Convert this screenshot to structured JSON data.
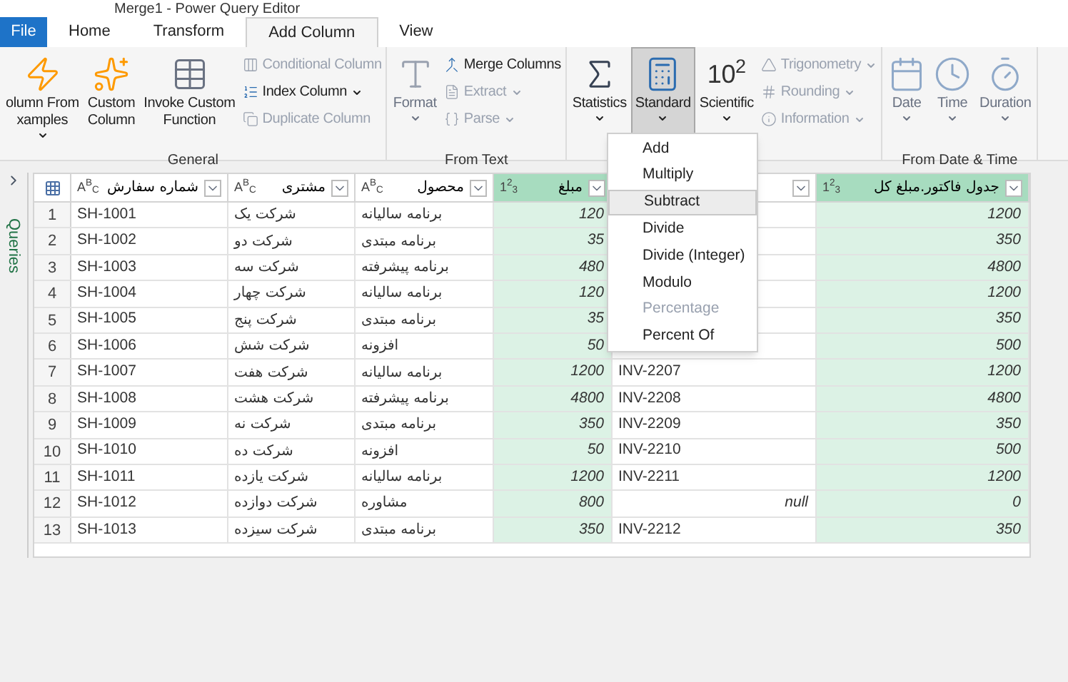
{
  "window": {
    "title": "Merge1 - Power Query Editor"
  },
  "tabs": [
    {
      "label": "File",
      "selected": false,
      "kind": "file"
    },
    {
      "label": "Home",
      "selected": false,
      "kind": "tab"
    },
    {
      "label": "Transform",
      "selected": false,
      "kind": "tab"
    },
    {
      "label": "Add Column",
      "selected": true,
      "kind": "tab"
    },
    {
      "label": "View",
      "selected": false,
      "kind": "tab"
    }
  ],
  "ribbon": [
    {
      "label": "General",
      "items": [
        {
          "kind": "large",
          "lines": [
            "olumn From",
            "xamples"
          ],
          "caret": true,
          "disabled": false,
          "pressed": false
        },
        {
          "kind": "large",
          "lines": [
            "Custom",
            "Column"
          ],
          "caret": false,
          "disabled": false,
          "pressed": false
        },
        {
          "kind": "large",
          "lines": [
            "Invoke Custom",
            "Function"
          ],
          "caret": false,
          "disabled": false,
          "pressed": false
        },
        {
          "kind": "stack",
          "entries": [
            {
              "label": "Conditional Column",
              "caret": false,
              "disabled": true
            },
            {
              "label": "Index Column",
              "caret": true,
              "disabled": false
            },
            {
              "label": "Duplicate Column",
              "caret": false,
              "disabled": true
            }
          ]
        }
      ]
    },
    {
      "label": "From Text",
      "items": [
        {
          "kind": "large",
          "lines": [
            "Format"
          ],
          "caret": true,
          "disabled": true,
          "pressed": false
        },
        {
          "kind": "stack",
          "entries": [
            {
              "label": "Merge Columns",
              "caret": false,
              "disabled": false
            },
            {
              "label": "Extract",
              "caret": true,
              "disabled": true
            },
            {
              "label": "Parse",
              "caret": true,
              "disabled": true
            }
          ]
        }
      ]
    },
    {
      "items": [
        {
          "kind": "large",
          "lines": [
            "Statistics"
          ],
          "caret": true,
          "disabled": false,
          "pressed": false
        },
        {
          "kind": "large",
          "lines": [
            "Standard"
          ],
          "caret": true,
          "disabled": false,
          "pressed": true
        },
        {
          "kind": "large",
          "lines": [
            "Scientific"
          ],
          "caret": true,
          "disabled": false,
          "pressed": false,
          "glyph": "10$^{2}$"
        },
        {
          "kind": "stack",
          "entries": [
            {
              "label": "Trigonometry",
              "caret": true,
              "disabled": true
            },
            {
              "label": "Rounding",
              "caret": true,
              "disabled": true
            },
            {
              "label": "Information",
              "caret": true,
              "disabled": true
            }
          ]
        }
      ]
    },
    {
      "label": "From Date & Time",
      "items": [
        {
          "kind": "large",
          "lines": [
            "Date"
          ],
          "caret": true,
          "disabled": true,
          "pressed": false
        },
        {
          "kind": "large",
          "lines": [
            "Time"
          ],
          "caret": true,
          "disabled": true,
          "pressed": false
        },
        {
          "kind": "large",
          "lines": [
            "Duration"
          ],
          "caret": true,
          "disabled": true,
          "pressed": false
        }
      ]
    }
  ],
  "queries_pane": {
    "label": "Queries"
  },
  "table": {
    "columns": [
      {
        "name": "شماره سفارش",
        "type": "A$^{B}$$_{C}$",
        "numeric": false
      },
      {
        "name": "مشتری",
        "type": "A$^{B}$$_{C}$",
        "numeric": false
      },
      {
        "name": "محصول",
        "type": "A$^{B}$$_{C}$",
        "numeric": false
      },
      {
        "name": "مبلغ",
        "type": "1$^{2}$$_{3}$",
        "numeric": true
      },
      {
        "numeric": false
      },
      {
        "name": "جدول فاکتور.مبلغ کل",
        "type": "1$^{2}$$_{3}$",
        "numeric": true
      }
    ],
    "rows": [
      {
        "num": "1",
        "cells": [
          "SH-1001",
          "شرکت یک",
          "برنامه سالیانه",
          "120",
          null,
          "1200"
        ]
      },
      {
        "num": "2",
        "cells": [
          "SH-1002",
          "شرکت دو",
          "برنامه مبتدی",
          "35",
          null,
          "350"
        ]
      },
      {
        "num": "3",
        "cells": [
          "SH-1003",
          "شرکت سه",
          "برنامه پیشرفته",
          "480",
          null,
          "4800"
        ]
      },
      {
        "num": "4",
        "cells": [
          "SH-1004",
          "شرکت چهار",
          "برنامه سالیانه",
          "120",
          null,
          "1200"
        ]
      },
      {
        "num": "5",
        "cells": [
          "SH-1005",
          "شرکت پنج",
          "برنامه مبتدی",
          "35",
          null,
          "350"
        ]
      },
      {
        "num": "6",
        "cells": [
          "SH-1006",
          "شرکت شش",
          "افزونه",
          "50",
          null,
          "500"
        ]
      },
      {
        "num": "7",
        "cells": [
          "SH-1007",
          "شرکت هفت",
          "برنامه سالیانه",
          "1200",
          "INV-2207",
          "1200"
        ]
      },
      {
        "num": "8",
        "cells": [
          "SH-1008",
          "شرکت هشت",
          "برنامه پیشرفته",
          "4800",
          "INV-2208",
          "4800"
        ]
      },
      {
        "num": "9",
        "cells": [
          "SH-1009",
          "شرکت نه",
          "برنامه مبتدی",
          "350",
          "INV-2209",
          "350"
        ]
      },
      {
        "num": "10",
        "cells": [
          "SH-1010",
          "شرکت ده",
          "افزونه",
          "50",
          "INV-2210",
          "500"
        ]
      },
      {
        "num": "11",
        "cells": [
          "SH-1011",
          "شرکت یازده",
          "برنامه سالیانه",
          "1200",
          "INV-2211",
          "1200"
        ]
      },
      {
        "num": "12",
        "cells": [
          "SH-1012",
          "شرکت دوازده",
          "مشاوره",
          "800",
          {
            "kind": "null",
            "text": "null"
          },
          "0"
        ]
      },
      {
        "num": "13",
        "cells": [
          "SH-1013",
          "شرکت سیزده",
          "برنامه مبتدی",
          "350",
          "INV-2212",
          "350"
        ]
      }
    ]
  },
  "standard_menu": [
    {
      "label": "Add",
      "selected": false,
      "disabled": false
    },
    {
      "label": "Multiply",
      "selected": false,
      "disabled": false
    },
    {
      "label": "Subtract",
      "selected": true,
      "disabled": false
    },
    {
      "label": "Divide",
      "selected": false,
      "disabled": false
    },
    {
      "label": "Divide (Integer)",
      "selected": false,
      "disabled": false
    },
    {
      "label": "Modulo",
      "selected": false,
      "disabled": false
    },
    {
      "label": "Percentage",
      "selected": false,
      "disabled": true
    },
    {
      "label": "Percent Of",
      "selected": false,
      "disabled": false
    }
  ]
}
